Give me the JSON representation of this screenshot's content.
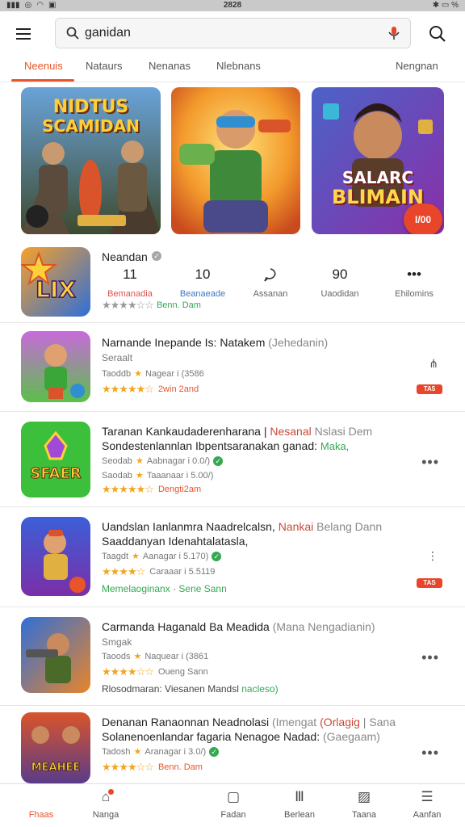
{
  "status_bar": {
    "time": "2828",
    "battery": "%"
  },
  "search": {
    "value": "ganidan"
  },
  "tabs": [
    "Neenuis",
    "Nataurs",
    "Nenanas",
    "Nlebnans",
    "Nengnan"
  ],
  "banners": [
    {
      "line1": "NIDTUS",
      "line2": "SCAMIDAN"
    },
    {
      "line1": ""
    },
    {
      "line1": "SALARC",
      "line2": "BLIMAIN",
      "badge": "I/00"
    }
  ],
  "featured": {
    "name": "Neandan",
    "stats": [
      {
        "value": "11",
        "label": "Bemanadia"
      },
      {
        "value": "10",
        "label": "Beanaeade"
      },
      {
        "value": "",
        "label": "Assanan"
      },
      {
        "value": "90",
        "label": "Uaodidan"
      },
      {
        "value": "",
        "label": "Ehilomins"
      }
    ],
    "rating_text": "Benn. Dam"
  },
  "apps": [
    {
      "title": "Narnande Inepande Is: Natakem",
      "title_extra": "(Jehedanin)",
      "subtitle": "Seraalt",
      "meta": "Nagear i (3586",
      "meta_prefix": "Taoddb",
      "rating_text": "2win 2and",
      "tag": "TA5"
    },
    {
      "title": "Taranan Kankaudaderenharana",
      "title_red": "Nesanal",
      "title_extra": "Nslasi Dem",
      "title2": "Sondestenlannlan Ibpentsaranakan ganad:",
      "title2_green": "Maka,",
      "meta": "Aabnagar i 0.0/)",
      "meta_prefix": "Seodab",
      "meta2": "Taaanaar i 5.00/)",
      "meta2_prefix": "Saodab",
      "rating_text": "Dengti2am"
    },
    {
      "title": "Uandslan Ianlanmra Naadrelcalsn,",
      "title_red": "Nankai",
      "title_extra": "Belang Dann",
      "title2": "Saaddanyan Idenahtalatasla,",
      "meta": "Aanagar i 5.170)",
      "meta_prefix": "Taagdt",
      "meta2": "Caraaar i 5.5119",
      "rating_text": "",
      "foot": "Memelaoginanx",
      "foot_green": "Sene Sann",
      "tag": "TAS"
    },
    {
      "title": "Carmanda Haganald Ba Meadida",
      "title_extra": "(Mana Nengadianin)",
      "subtitle": "Smgak",
      "meta": "Naquear i (3861",
      "meta_prefix": "Taoods",
      "rating_text": "Oueng Sann",
      "foot": "Rlosodmaran: Viesanen Mandsl",
      "foot_green": "nacleso)"
    },
    {
      "title": "Denanan Ranaonnan Neadnolasi",
      "title_extra": "(Imengat",
      "title_red": "(Orlagig",
      "title_extra2": "| Sana",
      "title2": "Solanenoenlandar fagaria Nenagoe Nadad:",
      "title2_extra": "(Gaegaam)",
      "meta": "Aranagar i 3.0/)",
      "meta_prefix": "Tadosh",
      "rating_text": "Benn. Dam"
    }
  ],
  "bottom_nav": [
    "Fhaas",
    "Nanga",
    "Fadan",
    "Berlean",
    "Taana",
    "Aanfan"
  ]
}
